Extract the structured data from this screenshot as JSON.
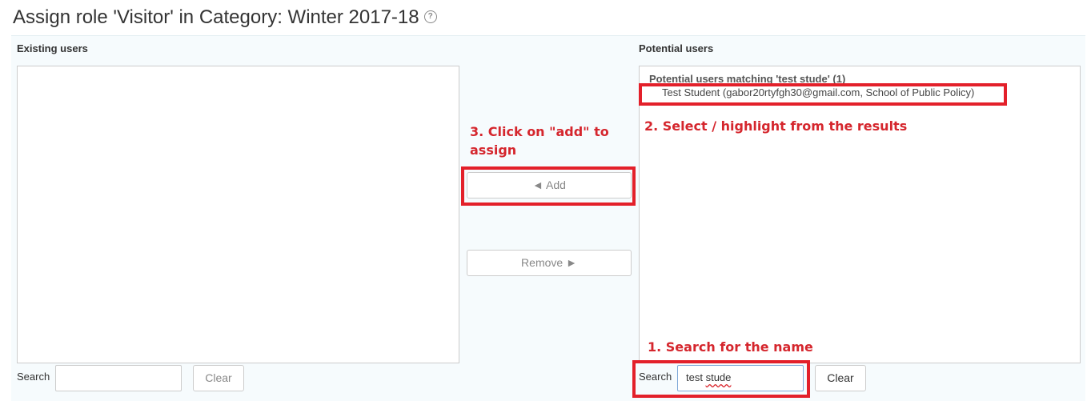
{
  "header": {
    "title": "Assign role 'Visitor' in Category: Winter 2017-18",
    "help_icon": "?"
  },
  "existing": {
    "heading": "Existing users",
    "search_label": "Search",
    "search_value": "",
    "clear_label": "Clear"
  },
  "actions": {
    "add_label": "◄ Add",
    "remove_label": "Remove ►"
  },
  "potential": {
    "heading": "Potential users",
    "group_label": "Potential users matching 'test stude' (1)",
    "option": "Test Student (gabor20rtyfgh30@gmail.com, School of Public Policy)",
    "search_label": "Search",
    "search_value": "test stude",
    "search_prefix": "test ",
    "search_misspelled": "stude",
    "clear_label": "Clear"
  },
  "annotations": {
    "step1": "1. Search for the name",
    "step2": "2. Select / highlight from the results",
    "step3": "3. Click on \"add\" to assign",
    "color": "#e3202a"
  }
}
